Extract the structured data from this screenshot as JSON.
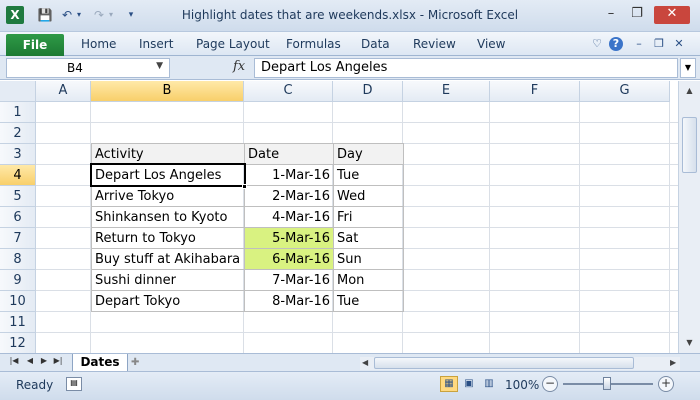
{
  "window": {
    "title": "Highlight dates that are weekends.xlsx - Microsoft Excel",
    "app_icon_letter": "X"
  },
  "ribbon": {
    "file_label": "File",
    "tabs": [
      "Home",
      "Insert",
      "Page Layout",
      "Formulas",
      "Data",
      "Review",
      "View"
    ]
  },
  "formula_bar": {
    "name_box": "B4",
    "fx": "fx",
    "value": "Depart Los Angeles"
  },
  "columns": [
    "A",
    "B",
    "C",
    "D",
    "E",
    "F",
    "G"
  ],
  "rows": [
    "1",
    "2",
    "3",
    "4",
    "5",
    "6",
    "7",
    "8",
    "9",
    "10",
    "11",
    "12"
  ],
  "table": {
    "headers": [
      "Activity",
      "Date",
      "Day"
    ],
    "rows": [
      {
        "activity": "Depart Los Angeles",
        "date": "1-Mar-16",
        "day": "Tue",
        "weekend": false
      },
      {
        "activity": "Arrive Tokyo",
        "date": "2-Mar-16",
        "day": "Wed",
        "weekend": false
      },
      {
        "activity": "Shinkansen to Kyoto",
        "date": "4-Mar-16",
        "day": "Fri",
        "weekend": false
      },
      {
        "activity": "Return to Tokyo",
        "date": "5-Mar-16",
        "day": "Sat",
        "weekend": true
      },
      {
        "activity": "Buy stuff at Akihabara",
        "date": "6-Mar-16",
        "day": "Sun",
        "weekend": true
      },
      {
        "activity": "Sushi dinner",
        "date": "7-Mar-16",
        "day": "Mon",
        "weekend": false
      },
      {
        "activity": "Depart Tokyo",
        "date": "8-Mar-16",
        "day": "Tue",
        "weekend": false
      }
    ]
  },
  "sheet_tabs": {
    "active": "Dates"
  },
  "status": {
    "ready": "Ready",
    "zoom": "100%"
  },
  "colors": {
    "highlight": "#d9f281",
    "file_tab": "#1c7a33",
    "selection_header": "#f8cf6a"
  }
}
